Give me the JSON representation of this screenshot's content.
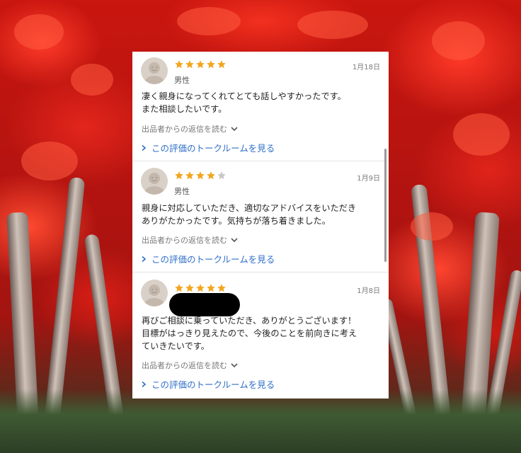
{
  "reviews": [
    {
      "rating": 5,
      "date": "1月18日",
      "gender": "男性",
      "text": "凄く親身になってくれてとても話しやすかったです。\nまた相談したいです。",
      "reply_label": "出品者からの返信を読む",
      "talk_label": "この評価のトークルームを見る"
    },
    {
      "rating": 4,
      "date": "1月9日",
      "gender": "男性",
      "text": "親身に対応していただき、適切なアドバイスをいただき\nありがたかったです。気持ちが落ち着きました。",
      "reply_label": "出品者からの返信を読む",
      "talk_label": "この評価のトークルームを見る"
    },
    {
      "rating": 5,
      "date": "1月8日",
      "gender": "",
      "text": "再びご相談に乗っていただき、ありがとうございます！\n目標がはっきり見えたので、今後のことを前向きに考え\nていきたいです。",
      "reply_label": "出品者からの返信を読む",
      "talk_label": "この評価のトークルームを見る"
    }
  ],
  "colors": {
    "star_filled": "#f2a61c",
    "star_empty": "#c8c8c8",
    "link": "#2f6fc9"
  }
}
